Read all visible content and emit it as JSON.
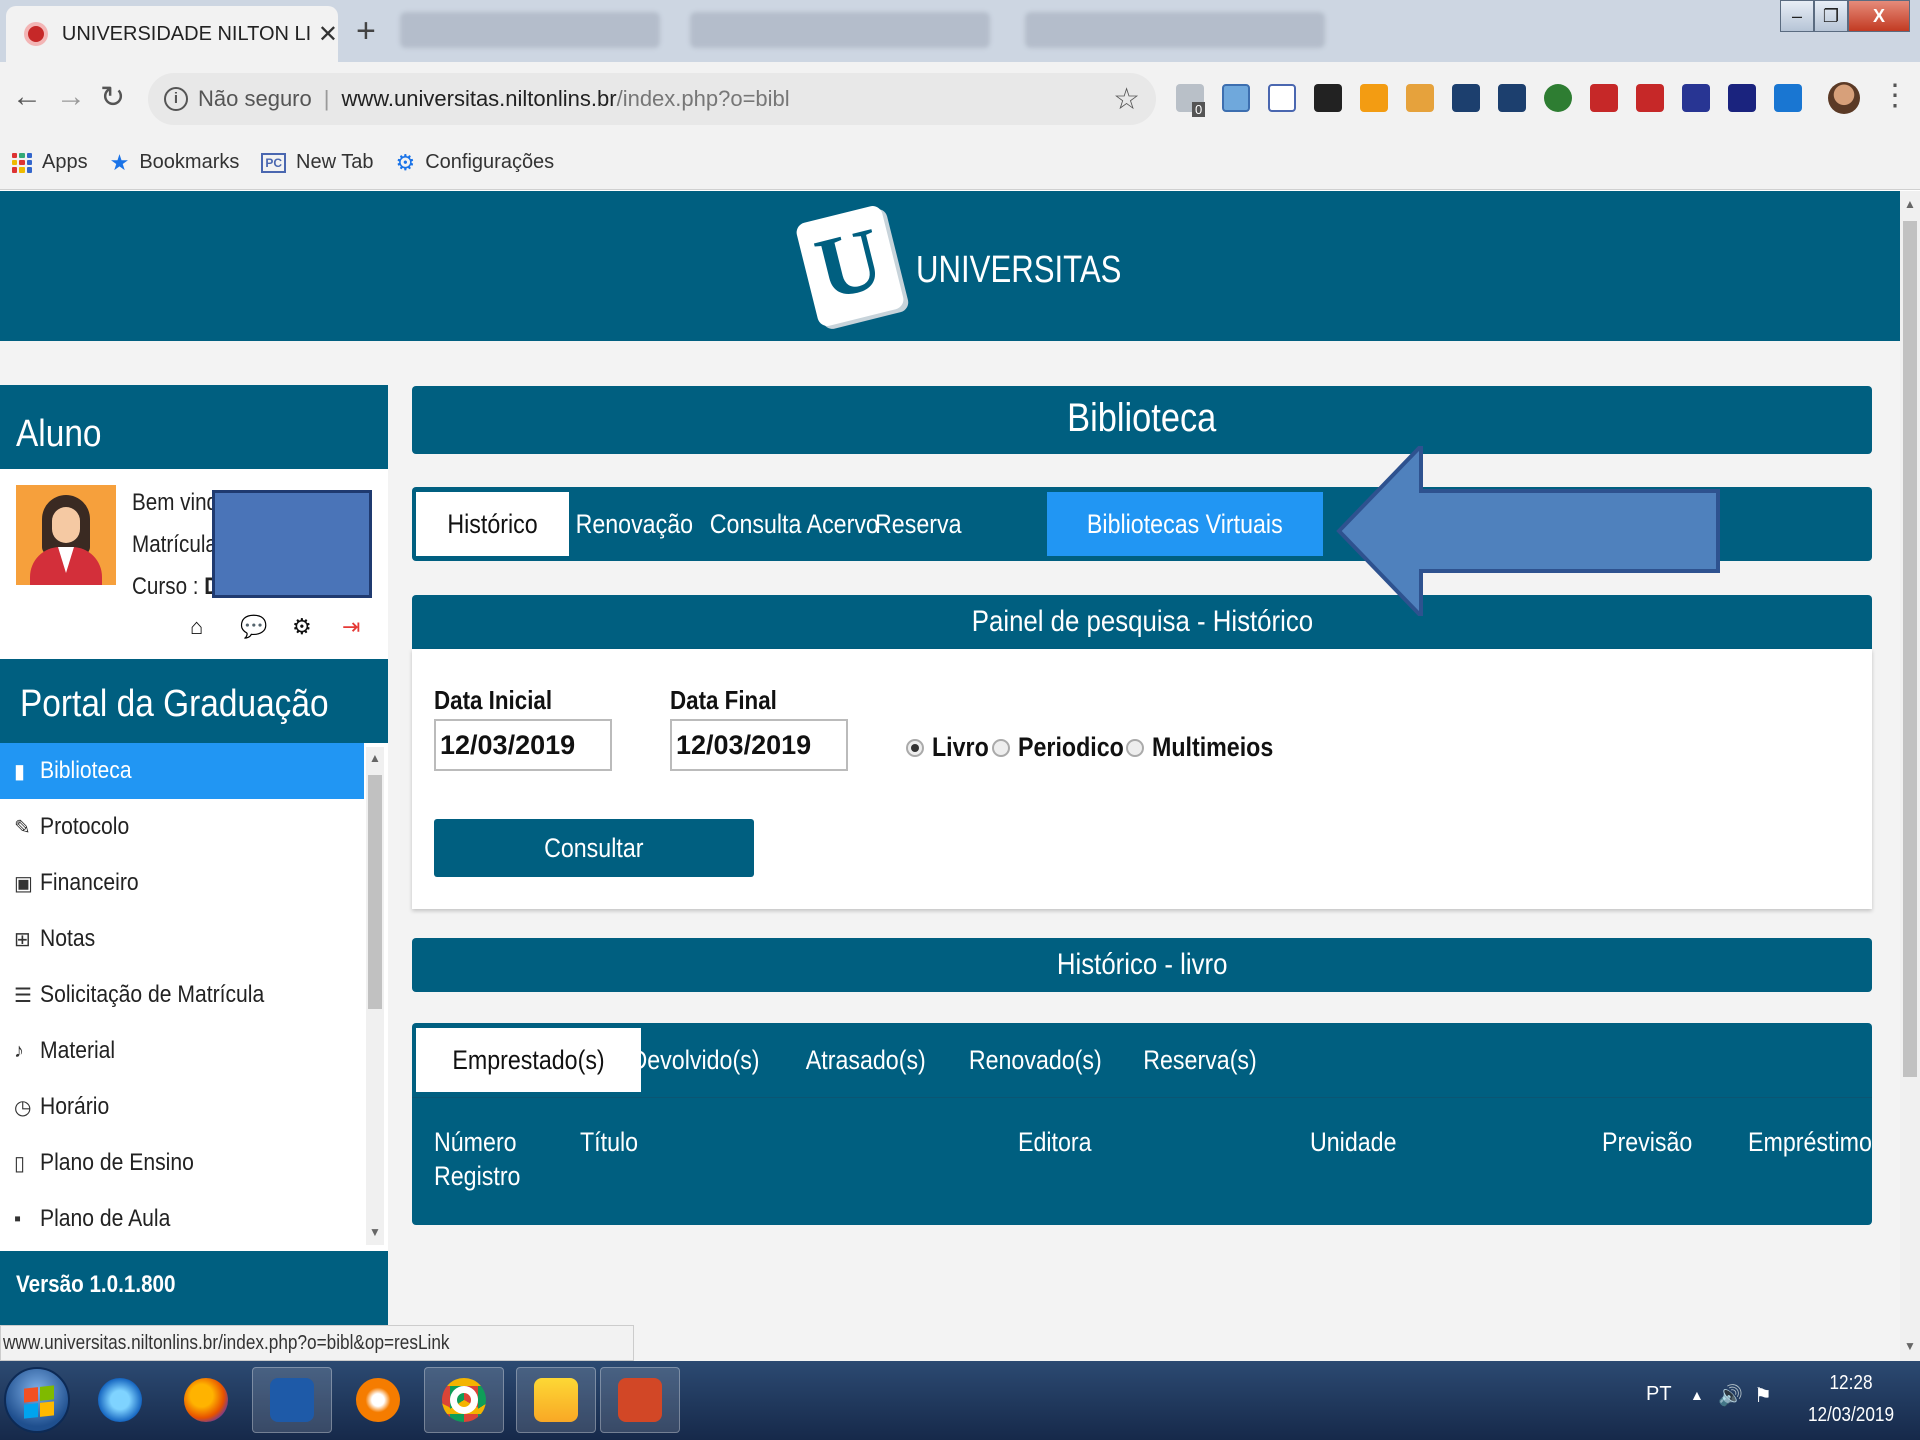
{
  "browser": {
    "tab_title": "UNIVERSIDADE NILTON LINS [ Po",
    "new_tab_symbol": "+",
    "security_label": "Não seguro",
    "url_host": "www.universitas.niltonlins.br",
    "url_path": "/index.php?o=bibl",
    "extension_badge": "0",
    "bookmarks": [
      {
        "label": "Apps"
      },
      {
        "label": "Bookmarks"
      },
      {
        "label": "New Tab"
      },
      {
        "label": "Configurações"
      }
    ],
    "status_url": "www.universitas.niltonlins.br/index.php?o=bibl&op=resLink"
  },
  "header": {
    "logo_letter": "U",
    "logo_text": "UNIVERSITAS"
  },
  "sidebar": {
    "aluno_heading": "Aluno",
    "welcome_label": "Bem vind",
    "matricula_label": "Matrícula",
    "curso_label": "Curso : ",
    "curso_value_fragment": "D",
    "portal_heading": "Portal da Graduação",
    "nav_items": [
      {
        "label": "Biblioteca",
        "icon": "book-icon",
        "active": true
      },
      {
        "label": "Protocolo",
        "icon": "edit-icon"
      },
      {
        "label": "Financeiro",
        "icon": "money-icon"
      },
      {
        "label": "Notas",
        "icon": "table-icon"
      },
      {
        "label": "Solicitação de Matrícula",
        "icon": "list-icon"
      },
      {
        "label": "Material",
        "icon": "file-audio-icon"
      },
      {
        "label": "Horário",
        "icon": "clock-icon"
      },
      {
        "label": "Plano de Ensino",
        "icon": "tablet-icon"
      },
      {
        "label": "Plano de Aula",
        "icon": "bookmark-icon"
      }
    ],
    "version": "Versão 1.0.1.800"
  },
  "main": {
    "title": "Biblioteca",
    "tabs": [
      {
        "label": "Histórico"
      },
      {
        "label": "Renovação"
      },
      {
        "label": "Consulta Acervo"
      },
      {
        "label": "Reserva"
      },
      {
        "label": "Bibliotecas Virtuais"
      }
    ],
    "search_panel": {
      "title": "Painel de pesquisa - Histórico",
      "data_inicial_label": "Data Inicial",
      "data_inicial_value": "12/03/2019",
      "data_final_label": "Data Final",
      "data_final_value": "12/03/2019",
      "radio_options": [
        {
          "label": "Livro",
          "checked": true
        },
        {
          "label": "Periodico",
          "checked": false
        },
        {
          "label": "Multimeios",
          "checked": false
        }
      ],
      "button_label": "Consultar"
    },
    "historico": {
      "title": "Histórico - livro",
      "tabs": [
        {
          "label": "Emprestado(s)"
        },
        {
          "label": "Devolvido(s)"
        },
        {
          "label": "Atrasado(s)"
        },
        {
          "label": "Renovado(s)"
        },
        {
          "label": "Reserva(s)"
        }
      ],
      "columns": [
        {
          "line1": "Número",
          "line2": "Registro"
        },
        {
          "line1": "Título"
        },
        {
          "line1": "Editora"
        },
        {
          "line1": "Unidade"
        },
        {
          "line1": "Previsão"
        },
        {
          "line1": "Empréstimo"
        }
      ]
    }
  },
  "annotation": {
    "arrow_color": "#4f81bd",
    "arrow_border": "#2e528f"
  },
  "taskbar": {
    "language": "PT",
    "time": "12:28",
    "date": "12/03/2019"
  },
  "colors": {
    "primary": "#005f80",
    "highlight": "#2196f3"
  }
}
